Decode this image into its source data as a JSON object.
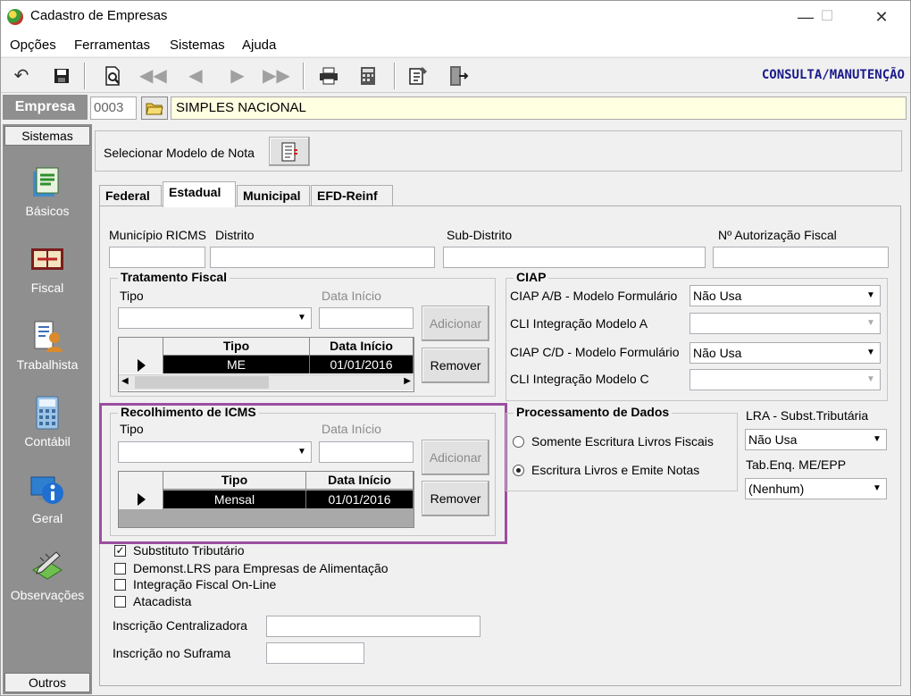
{
  "window": {
    "title": "Cadastro de Empresas",
    "minimize": "—",
    "maximize": "☐",
    "close": "✕"
  },
  "menu": [
    "Opções",
    "Ferramentas",
    "Sistemas",
    "Ajuda"
  ],
  "toolbar": {
    "mode_label": "CONSULTA/MANUTENÇÃO"
  },
  "empresa": {
    "label": "Empresa",
    "code": "0003",
    "name": "SIMPLES NACIONAL"
  },
  "sidebar": {
    "header": "Sistemas",
    "footer": "Outros",
    "items": [
      {
        "label": "Básicos",
        "icon": "basicos-icon"
      },
      {
        "label": "Fiscal",
        "icon": "fiscal-icon"
      },
      {
        "label": "Trabalhista",
        "icon": "trabalhista-icon"
      },
      {
        "label": "Contábil",
        "icon": "contabil-icon"
      },
      {
        "label": "Geral",
        "icon": "info-icon"
      },
      {
        "label": "Observações",
        "icon": "observacoes-icon"
      }
    ]
  },
  "modelo": {
    "label": "Selecionar Modelo de Nota"
  },
  "tabs": [
    "Federal",
    "Estadual",
    "Municipal",
    "EFD-Reinf"
  ],
  "active_tab": "Estadual",
  "estadual": {
    "municipio_label": "Município RICMS",
    "distrito_label": "Distrito",
    "subdistrito_label": "Sub-Distrito",
    "autorizacao_label": "Nº Autorização Fiscal",
    "tratamento": {
      "title": "Tratamento Fiscal",
      "tipo_label": "Tipo",
      "data_label": "Data Início",
      "add_label": "Adicionar",
      "remove_label": "Remover",
      "columns": [
        "Tipo",
        "Data Início"
      ],
      "rows": [
        {
          "tipo": "ME",
          "data": "01/01/2016"
        }
      ]
    },
    "recolhimento": {
      "title": "Recolhimento de ICMS",
      "tipo_label": "Tipo",
      "data_label": "Data Início",
      "add_label": "Adicionar",
      "remove_label": "Remover",
      "columns": [
        "Tipo",
        "Data Início"
      ],
      "rows": [
        {
          "tipo": "Mensal",
          "data": "01/01/2016"
        }
      ]
    },
    "ciap": {
      "title": "CIAP",
      "ab_label": "CIAP  A/B - Modelo Formulário",
      "ab_value": "Não Usa",
      "cli_a_label": "CLI Integração Modelo A",
      "cd_label": "CIAP C/D - Modelo Formulário",
      "cd_value": "Não Usa",
      "cli_c_label": "CLI Integração Modelo C"
    },
    "processamento": {
      "title": "Processamento de Dados",
      "opt1": "Somente Escritura Livros Fiscais",
      "opt2": "Escritura Livros e Emite Notas",
      "selected": 2
    },
    "lra": {
      "label": "LRA - Subst.Tributária",
      "value": "Não Usa"
    },
    "tabenq": {
      "label": "Tab.Enq. ME/EPP",
      "value": "(Nenhum)"
    },
    "checks": [
      {
        "label": "Substituto Tributário",
        "checked": true
      },
      {
        "label": "Demonst.LRS para Empresas de Alimentação",
        "checked": false
      },
      {
        "label": "Integração Fiscal On-Line",
        "checked": false
      },
      {
        "label": "Atacadista",
        "checked": false
      }
    ],
    "insc_centralizadora_label": "Inscrição Centralizadora",
    "insc_suframa_label": "Inscrição no Suframa"
  },
  "colors": {
    "highlight": "#9b4fa0",
    "mode_label": "#1a1a8c",
    "empresa_name_bg": "#ffffe1"
  }
}
